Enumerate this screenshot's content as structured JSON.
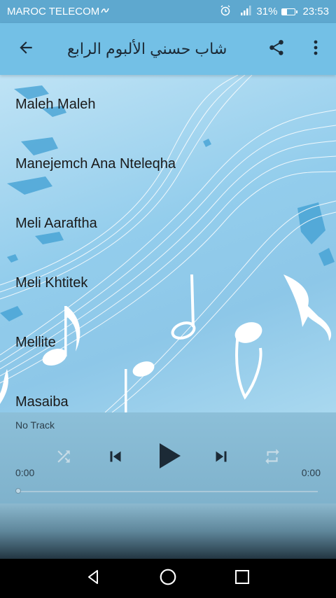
{
  "status_bar": {
    "carrier": "MAROC TELECOM",
    "battery": "31%",
    "time": "23:53",
    "icons": [
      "carrier-link-icon",
      "alarm-icon",
      "signal-icon",
      "battery-icon"
    ]
  },
  "app_bar": {
    "title": "شاب حسني الألبوم الرابع",
    "background": "#73c0e6",
    "icons": [
      "back-arrow-icon",
      "share-icon",
      "more-vert-icon"
    ]
  },
  "songs": [
    "Maleh Maleh",
    "Manejemch Ana Nteleqha",
    "Meli Aaraftha",
    "Meli Khtitek",
    "Mellite",
    "Masaiba"
  ],
  "player": {
    "track": "No Track",
    "current_time": "0:00",
    "total_time": "0:00",
    "progress": 0,
    "icons": [
      "shuffle-icon",
      "skip-previous-icon",
      "play-icon",
      "skip-next-icon",
      "repeat-icon"
    ]
  },
  "nav_bar": {
    "icons": [
      "nav-back-icon",
      "nav-home-icon",
      "nav-recents-icon"
    ]
  }
}
